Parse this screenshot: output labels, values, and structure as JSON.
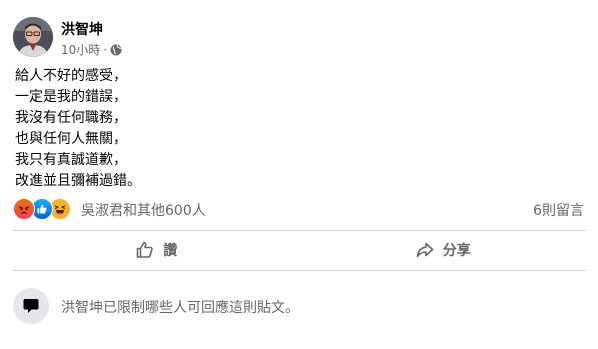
{
  "post": {
    "author": "洪智坤",
    "time": "10小時",
    "separator": "·",
    "privacy_icon": "globe-icon",
    "body_lines": [
      "給人不好的感受，",
      "一定是我的錯誤，",
      "我沒有任何職務，",
      "也與任何人無關，",
      "我只有真誠道歉，",
      "改進並且彌補過錯。"
    ]
  },
  "reactions": {
    "icons": [
      "angry-reaction-icon",
      "like-reaction-icon",
      "haha-reaction-icon"
    ],
    "summary": "吳淑君和其他600人",
    "comments": "6則留言"
  },
  "actions": {
    "like_label": "讚",
    "share_label": "分享"
  },
  "restriction": {
    "text": "洪智坤已限制哪些人可回應這則貼文。"
  },
  "colors": {
    "secondary_text": "#65676b",
    "divider": "#ced0d4",
    "like_blue": "#0866ff",
    "angry_orange": "#e9710f",
    "haha_yellow": "#f7b125"
  }
}
